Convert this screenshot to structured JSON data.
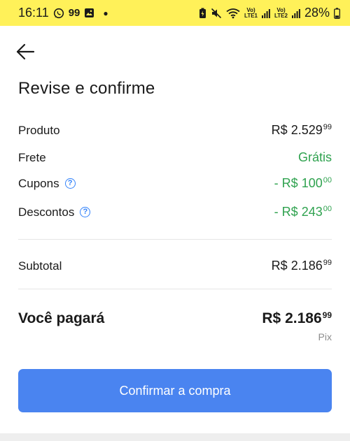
{
  "status_bar": {
    "time": "16:11",
    "badge_99": "99",
    "net1": "Vo)",
    "net1_sub": "LTE1",
    "net2": "Vo)",
    "net2_sub": "LTE2",
    "battery": "28%"
  },
  "header": {
    "title": "Revise e confirme"
  },
  "summary": {
    "produto": {
      "label": "Produto",
      "currency": "R$",
      "value": "2.529",
      "cents": "99"
    },
    "frete": {
      "label": "Frete",
      "value": "Grátis"
    },
    "cupons": {
      "label": "Cupons",
      "prefix": "- R$",
      "value": "100",
      "cents": "00"
    },
    "descontos": {
      "label": "Descontos",
      "prefix": "- R$",
      "value": "243",
      "cents": "00"
    },
    "subtotal": {
      "label": "Subtotal",
      "currency": "R$",
      "value": "2.186",
      "cents": "99"
    }
  },
  "total": {
    "label": "Você pagará",
    "currency": "R$",
    "value": "2.186",
    "cents": "99",
    "method": "Pix"
  },
  "actions": {
    "confirm_label": "Confirmar a compra"
  },
  "colors": {
    "status_bar_bg": "#fff159",
    "accent_blue": "#4a84f0",
    "discount_green": "#2fa24f"
  }
}
